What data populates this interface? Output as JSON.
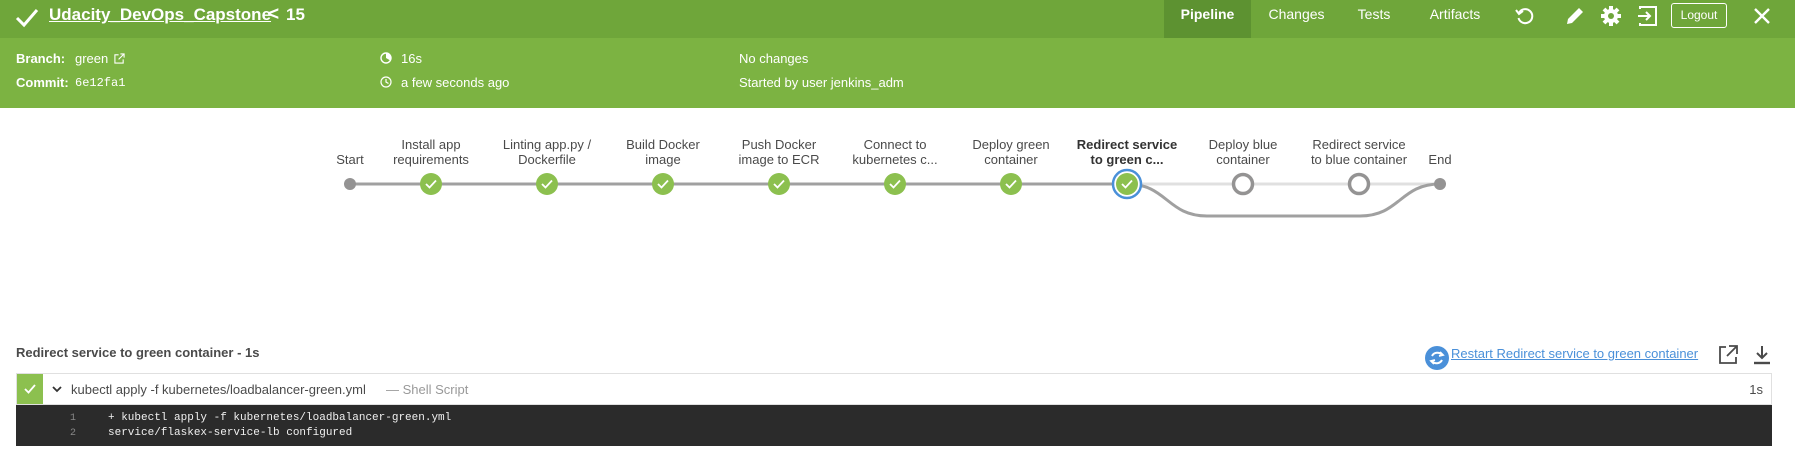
{
  "header": {
    "pipeline_name": "Udacity_DevOps_Capstone",
    "run_number": "15",
    "chevron": "<",
    "tabs": [
      {
        "label": "Pipeline",
        "active": true
      },
      {
        "label": "Changes",
        "active": false
      },
      {
        "label": "Tests",
        "active": false
      },
      {
        "label": "Artifacts",
        "active": false
      }
    ],
    "icons": [
      "rerun-icon",
      "edit-icon",
      "settings-icon",
      "exit-icon",
      "close-icon"
    ],
    "logout_label": "Logout",
    "colors": {
      "bar": "#6fa63a",
      "info_bar": "#7cb342",
      "active_tab": "#5d9231"
    }
  },
  "info": {
    "branch_label": "Branch:",
    "branch_value": "green",
    "commit_label": "Commit:",
    "commit_value": "6e12fa1",
    "duration": "16s",
    "time_ago": "a few seconds ago",
    "changes": "No changes",
    "started_by": "Started by user jenkins_adm"
  },
  "pipeline": {
    "start_label": "Start",
    "end_label": "End",
    "stages": [
      {
        "line1": "Install app",
        "line2": "requirements",
        "status": "success"
      },
      {
        "line1": "Linting app.py /",
        "line2": "Dockerfile",
        "status": "success"
      },
      {
        "line1": "Build Docker",
        "line2": "image",
        "status": "success"
      },
      {
        "line1": "Push Docker",
        "line2": "image to ECR",
        "status": "success"
      },
      {
        "line1": "Connect to",
        "line2": "kubernetes c...",
        "status": "success"
      },
      {
        "line1": "Deploy green",
        "line2": "container",
        "status": "success"
      },
      {
        "line1": "Redirect service",
        "line2": "to green c...",
        "status": "selected"
      },
      {
        "line1": "Deploy blue",
        "line2": "container",
        "status": "skipped"
      },
      {
        "line1": "Redirect service",
        "line2": "to blue container",
        "status": "skipped"
      }
    ],
    "colors": {
      "success": "#8cc04f",
      "selected_ring": "#4a90d9",
      "line": "#a0a0a0",
      "skipped": "#949393"
    }
  },
  "step": {
    "title": "Redirect service to green container - 1s",
    "restart_label": "Restart Redirect service to green container",
    "command": "kubectl apply -f kubernetes/loadbalancer-green.yml",
    "type": "— Shell Script",
    "duration": "1s",
    "log": [
      {
        "n": "1",
        "text": "+ kubectl apply -f kubernetes/loadbalancer-green.yml"
      },
      {
        "n": "2",
        "text": "service/flaskex-service-lb configured"
      }
    ]
  }
}
